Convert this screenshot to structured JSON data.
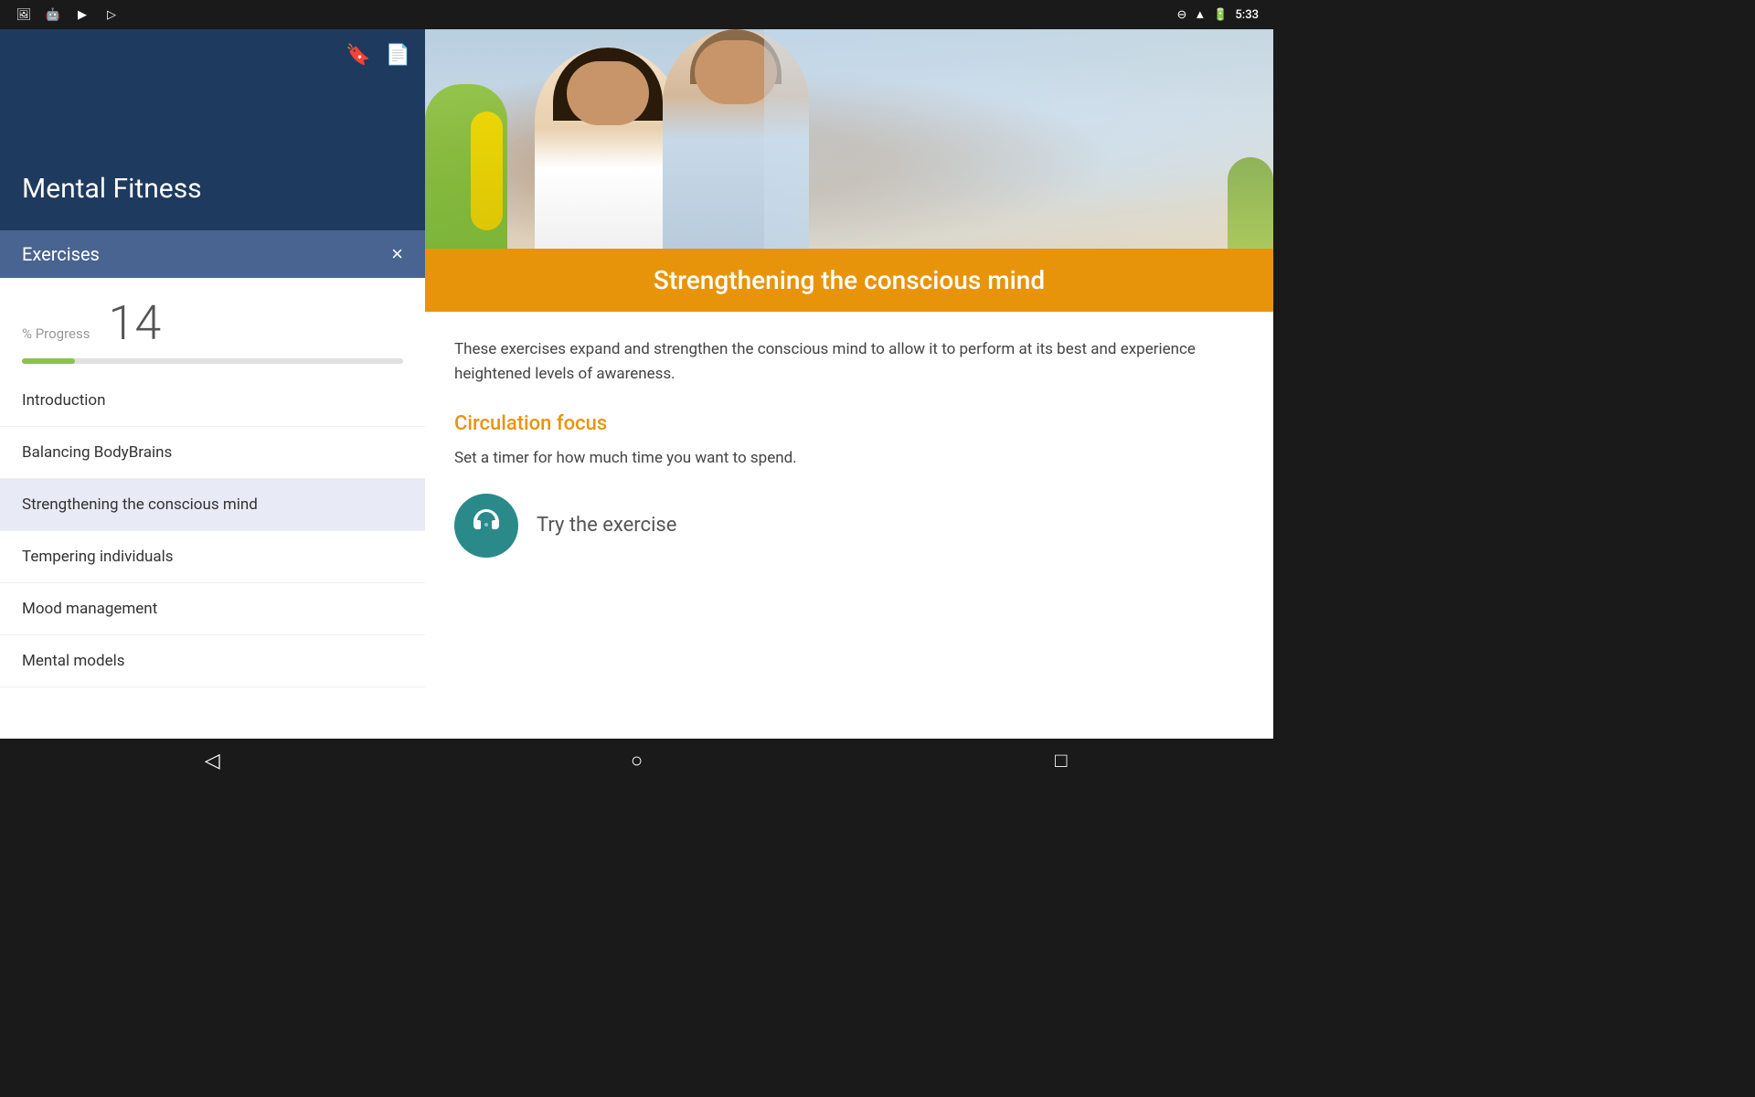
{
  "statusBar": {
    "time": "5:33",
    "icons": [
      "photo-icon",
      "android-icon",
      "play-icon",
      "store-icon"
    ]
  },
  "sidebar": {
    "title": "Mental Fitness",
    "exercisesLabel": "Exercises",
    "closeButton": "×",
    "bookmarkIcon": "🔖",
    "addFileIcon": "📄",
    "progress": {
      "label": "% Progress",
      "value": "14",
      "percent": 14
    },
    "navItems": [
      {
        "label": "Introduction",
        "active": false
      },
      {
        "label": "Balancing BodyBrains",
        "active": false
      },
      {
        "label": "Strengthening the conscious mind",
        "active": true
      },
      {
        "label": "Tempering individuals",
        "active": false
      },
      {
        "label": "Mood management",
        "active": false
      },
      {
        "label": "Mental models",
        "active": false
      }
    ]
  },
  "content": {
    "heroTitle": "Strengthening the conscious mind",
    "description": "These exercises expand and strengthen the conscious mind to allow it to perform at its best and experience heightened levels of awareness.",
    "sectionTitle": "Circulation focus",
    "sectionText": "Set a timer for how much time you want to spend.",
    "exerciseButtonLabel": "Try the exercise",
    "exerciseIcon": "🎧"
  },
  "bottomNav": {
    "back": "◁",
    "home": "○",
    "recent": "□"
  }
}
